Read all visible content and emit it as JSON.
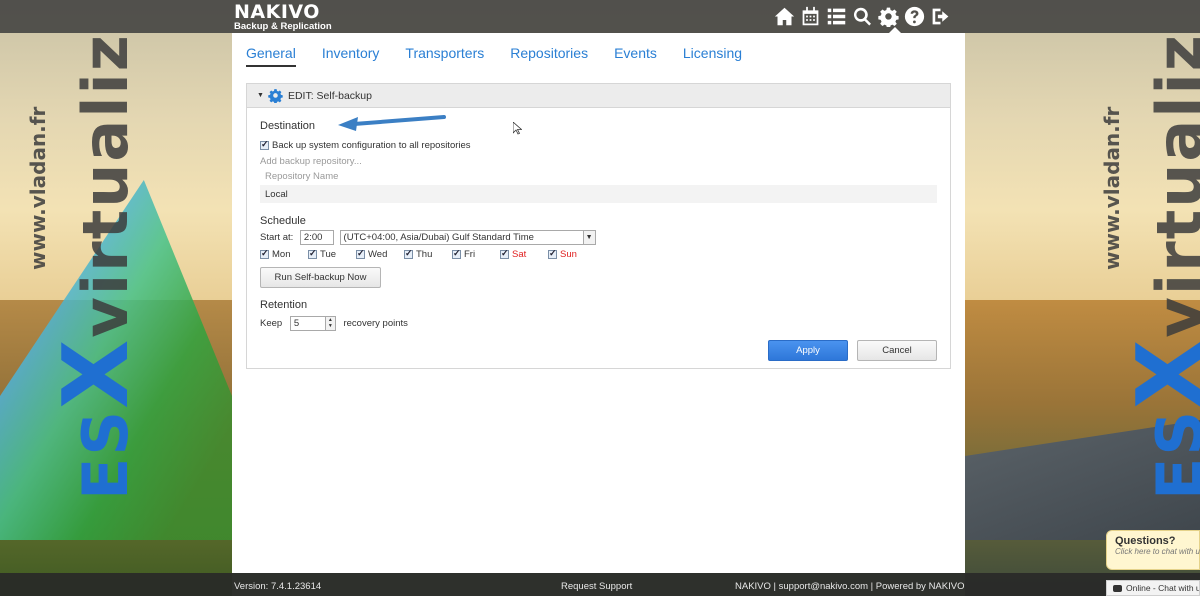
{
  "brand": {
    "name": "NAKIVO",
    "subtitle": "Backup & Replication"
  },
  "header_icons": [
    "home-icon",
    "calendar-icon",
    "list-icon",
    "search-icon",
    "gear-icon",
    "help-icon",
    "logout-icon"
  ],
  "tabs": [
    "General",
    "Inventory",
    "Transporters",
    "Repositories",
    "Events",
    "Licensing"
  ],
  "edit_title": "EDIT: Self-backup",
  "destination": {
    "title": "Destination",
    "backup_all_label": "Back up system configuration to all repositories",
    "add_repo_label": "Add backup repository...",
    "column_header": "Repository Name",
    "repo_value": "Local"
  },
  "schedule": {
    "title": "Schedule",
    "start_label": "Start at:",
    "start_time": "2:00",
    "timezone": "(UTC+04:00, Asia/Dubai) Gulf Standard Time",
    "days": [
      "Mon",
      "Tue",
      "Wed",
      "Thu",
      "Fri",
      "Sat",
      "Sun"
    ],
    "run_button": "Run Self-backup Now"
  },
  "retention": {
    "title": "Retention",
    "keep_label": "Keep",
    "keep_value": "5",
    "points_label": "recovery points"
  },
  "actions": {
    "apply": "Apply",
    "cancel": "Cancel"
  },
  "footer": {
    "version": "Version: 7.4.1.23614",
    "request_support": "Request Support",
    "company_info": "NAKIVO | support@nakivo.com | Powered by NAKIVO"
  },
  "chat": {
    "question": "Questions?",
    "cta": "Click here to chat with us",
    "status": "Online - Chat with us"
  },
  "watermark": {
    "url": "www.vladan.fr",
    "es": "ES",
    "x": "X",
    "rest": "virtualiz"
  },
  "colors": {
    "accent": "#2a7fd4",
    "weekend": "#e02020",
    "apply": "#2e77d9"
  }
}
